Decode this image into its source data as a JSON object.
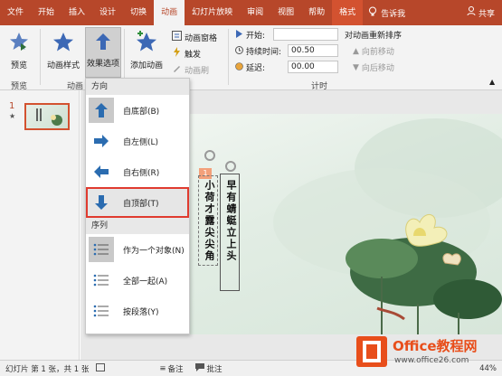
{
  "tabs": [
    "文件",
    "开始",
    "插入",
    "设计",
    "切换",
    "动画",
    "幻灯片放映",
    "审阅",
    "视图",
    "帮助",
    "格式"
  ],
  "tell_me": "告诉我",
  "share": "共享",
  "ribbon": {
    "preview": "预览",
    "preview_group": "预览",
    "anim_style": "动画样式",
    "effect_options": "效果选项",
    "anim_group": "动画",
    "add_anim": "添加动画",
    "anim_pane": "动画窗格",
    "trigger": "触发",
    "anim_brush": "动画刷",
    "start_label": "开始:",
    "duration_label": "持续时间:",
    "duration_value": "00.50",
    "delay_label": "延迟:",
    "delay_value": "00.00",
    "timing_group": "计时",
    "reorder": "对动画重新排序",
    "move_earlier": "向前移动",
    "move_later": "向后移动"
  },
  "slide_panel": {
    "number": "1",
    "star": "★"
  },
  "menu": {
    "direction_header": "方向",
    "items": [
      {
        "label": "自底部(B)",
        "icon": "arrow-up-icon"
      },
      {
        "label": "自左侧(L)",
        "icon": "arrow-right-icon"
      },
      {
        "label": "自右侧(R)",
        "icon": "arrow-left-icon"
      },
      {
        "label": "自顶部(T)",
        "icon": "arrow-down-icon"
      }
    ],
    "sequence_header": "序列",
    "seq_items": [
      {
        "label": "作为一个对象(N)"
      },
      {
        "label": "全部一起(A)"
      },
      {
        "label": "按段落(Y)"
      }
    ]
  },
  "slide": {
    "poem_col1": "早有蜻蜓立上头",
    "poem_col2": "小荷才露尖尖角",
    "anim_tag": "1"
  },
  "status": {
    "slide_info": "幻灯片 第 1 张，共 1 张",
    "notes": "备注",
    "comments": "批注",
    "zoom": "44%"
  },
  "logo": {
    "main": "Office教程网",
    "sub": "www.office26.com"
  },
  "colors": {
    "accent": "#b7472a",
    "highlight": "#e03b2f",
    "arrow": "#2b6cb0"
  }
}
